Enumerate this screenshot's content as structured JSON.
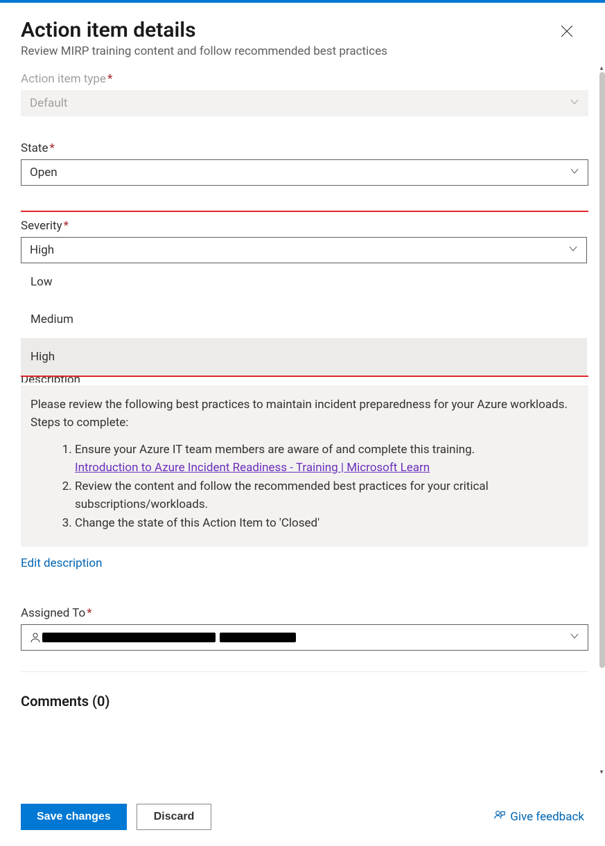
{
  "header": {
    "title": "Action item details",
    "subtitle": "Review MIRP training content and follow recommended best practices"
  },
  "fields": {
    "action_item_type": {
      "label": "Action item type",
      "value": "Default"
    },
    "state": {
      "label": "State",
      "value": "Open"
    },
    "severity": {
      "label": "Severity",
      "value": "High",
      "options": [
        "Low",
        "Medium",
        "High"
      ]
    },
    "description": {
      "hidden_label": "Description",
      "intro": "Please review the following best practices to maintain incident preparedness for your Azure workloads. Steps to complete:",
      "step1": "Ensure your Azure IT team members are aware of and complete this training.",
      "link1": "Introduction to Azure Incident Readiness - Training | Microsoft Learn",
      "step2": "Review the content and follow the recommended best practices for your critical subscriptions/workloads.",
      "step3": "Change the state of this Action Item to 'Closed'",
      "edit_label": "Edit description"
    },
    "assigned_to": {
      "label": "Assigned To"
    }
  },
  "comments": {
    "title": "Comments (0)"
  },
  "footer": {
    "save": "Save changes",
    "discard": "Discard",
    "feedback": "Give feedback"
  }
}
